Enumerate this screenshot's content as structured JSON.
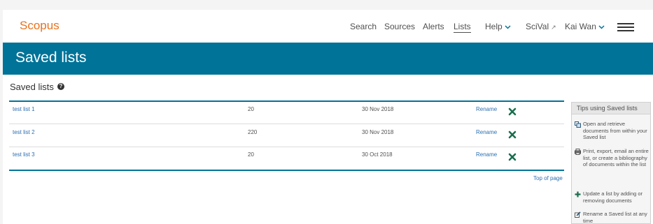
{
  "header": {
    "logo": "Scopus",
    "nav": {
      "search": "Search",
      "sources": "Sources",
      "alerts": "Alerts",
      "lists": "Lists",
      "help": "Help",
      "scival": "SciVal",
      "user": "Kai Wan"
    }
  },
  "banner": {
    "title": "Saved lists"
  },
  "section": {
    "title": "Saved lists"
  },
  "lists": [
    {
      "name": "test list 1",
      "count": "20",
      "date": "30 Nov 2018",
      "rename": "Rename"
    },
    {
      "name": "test list 2",
      "count": "220",
      "date": "30 Nov 2018",
      "rename": "Rename"
    },
    {
      "name": "test list 3",
      "count": "20",
      "date": "30 Oct 2018",
      "rename": "Rename"
    }
  ],
  "top_of_page": "Top of page",
  "tips": {
    "title": "Tips using Saved lists",
    "items": [
      {
        "icon": "open-list-icon",
        "text": "Open and retrieve documents from within your Saved list"
      },
      {
        "icon": "print-export-icon",
        "text": "Print, export, email an entire list, or create a bibliography of documents within the list"
      },
      {
        "icon": "plus-icon",
        "text": "Update a list by adding or removing documents"
      },
      {
        "icon": "rename-icon",
        "text": "Rename a Saved list at any time"
      }
    ]
  },
  "colors": {
    "brand_orange": "#e9711c",
    "banner_teal": "#007398",
    "link_blue": "#2e6fb0",
    "delete_green": "#1a6e4d"
  }
}
